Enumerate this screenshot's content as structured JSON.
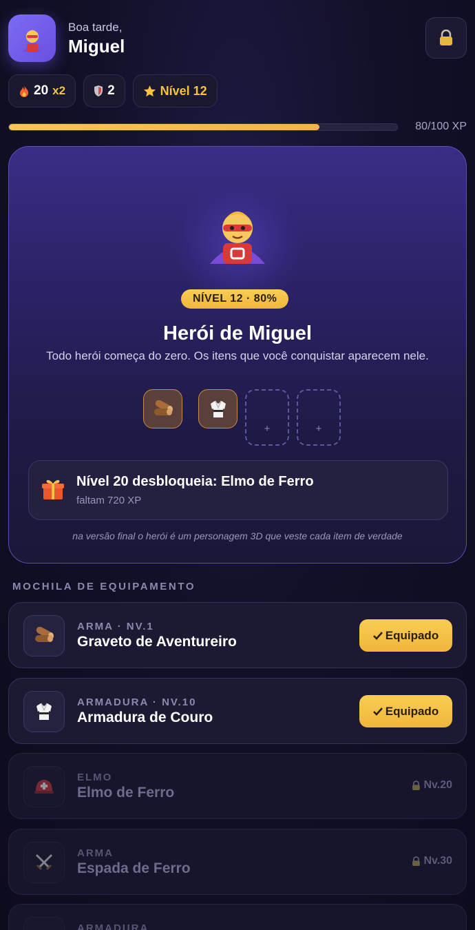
{
  "header": {
    "greeting": "Boa tarde,",
    "user_name": "Miguel",
    "avatar_icon": "superhero-icon",
    "lock_icon": "lock-icon"
  },
  "stats": {
    "streak_value": "20",
    "streak_multiplier": "x2",
    "shields_value": "2",
    "level_label": "Nível 12"
  },
  "xp": {
    "current": 80,
    "max": 100,
    "text": "80/100 XP"
  },
  "hero": {
    "level_badge": "NÍVEL 12 · 80%",
    "title": "Herói de Miguel",
    "subtitle": "Todo herói começa do zero. Os itens que você conquistar aparecem nele.",
    "slots": [
      {
        "icon": "wood-icon",
        "filled": true
      },
      {
        "icon": "gi-armor-icon",
        "filled": true
      },
      {
        "label": "+",
        "filled": false
      },
      {
        "label": "+",
        "filled": false
      }
    ],
    "unlock": {
      "title": "Nível 20 desbloqueia: Elmo de Ferro",
      "subtitle": "faltam 720 XP"
    },
    "note": "na versão final o herói é um personagem 3D que veste cada item de verdade"
  },
  "backpack": {
    "title": "MOCHILA DE EQUIPAMENTO",
    "items": [
      {
        "category": "ARMA · NV.1",
        "name": "Graveto de Aventureiro",
        "icon": "wood-icon",
        "status": "Equipado"
      },
      {
        "category": "ARMADURA · NV.10",
        "name": "Armadura de Couro",
        "icon": "gi-armor-icon",
        "status": "Equipado"
      },
      {
        "category": "ELMO",
        "name": "Elmo de Ferro",
        "icon": "helmet-icon",
        "status": "Nv.20"
      },
      {
        "category": "ARMA",
        "name": "Espada de Ferro",
        "icon": "crossed-swords-icon",
        "status": "Nv.30"
      },
      {
        "category": "ARMADURA",
        "name": "",
        "icon": "armor-icon",
        "status": ""
      }
    ]
  }
}
